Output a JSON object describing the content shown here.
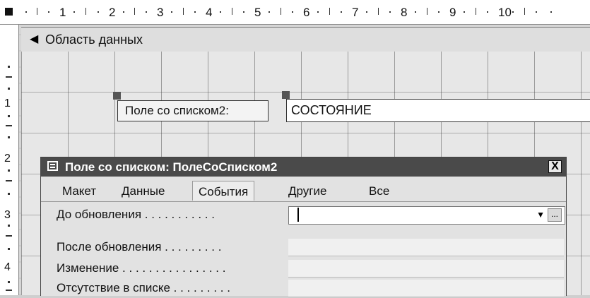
{
  "ruler": {
    "top_numbers": [
      "1",
      "2",
      "3",
      "4",
      "5",
      "6",
      "7",
      "8",
      "9",
      "10"
    ],
    "left_numbers": [
      "1",
      "2",
      "3",
      "4"
    ]
  },
  "section": {
    "label": "Область данных",
    "arrow_icon": "collapse-arrow-icon"
  },
  "form_controls": {
    "label_text": "Поле со списком2:",
    "field_value": "СОСТОЯНИЕ"
  },
  "properties_window": {
    "title": "Поле со списком: ПолеСоСписком2",
    "close_label": "X",
    "tabs": [
      {
        "label": "Макет",
        "active": false
      },
      {
        "label": "Данные",
        "active": false
      },
      {
        "label": "События",
        "active": true
      },
      {
        "label": "Другие",
        "active": false
      },
      {
        "label": "Все",
        "active": false
      }
    ],
    "dropdown_glyph": "▼",
    "builder_label": "...",
    "rows": [
      {
        "label": "До обновления . . . . . . . . . . ."
      },
      {
        "label": "После обновления . . . . . . . . ."
      },
      {
        "label": "Изменение . . . . . . . . . . . . . . . ."
      },
      {
        "label": "Отсутствие в списке . . . . . . . . ."
      }
    ]
  }
}
